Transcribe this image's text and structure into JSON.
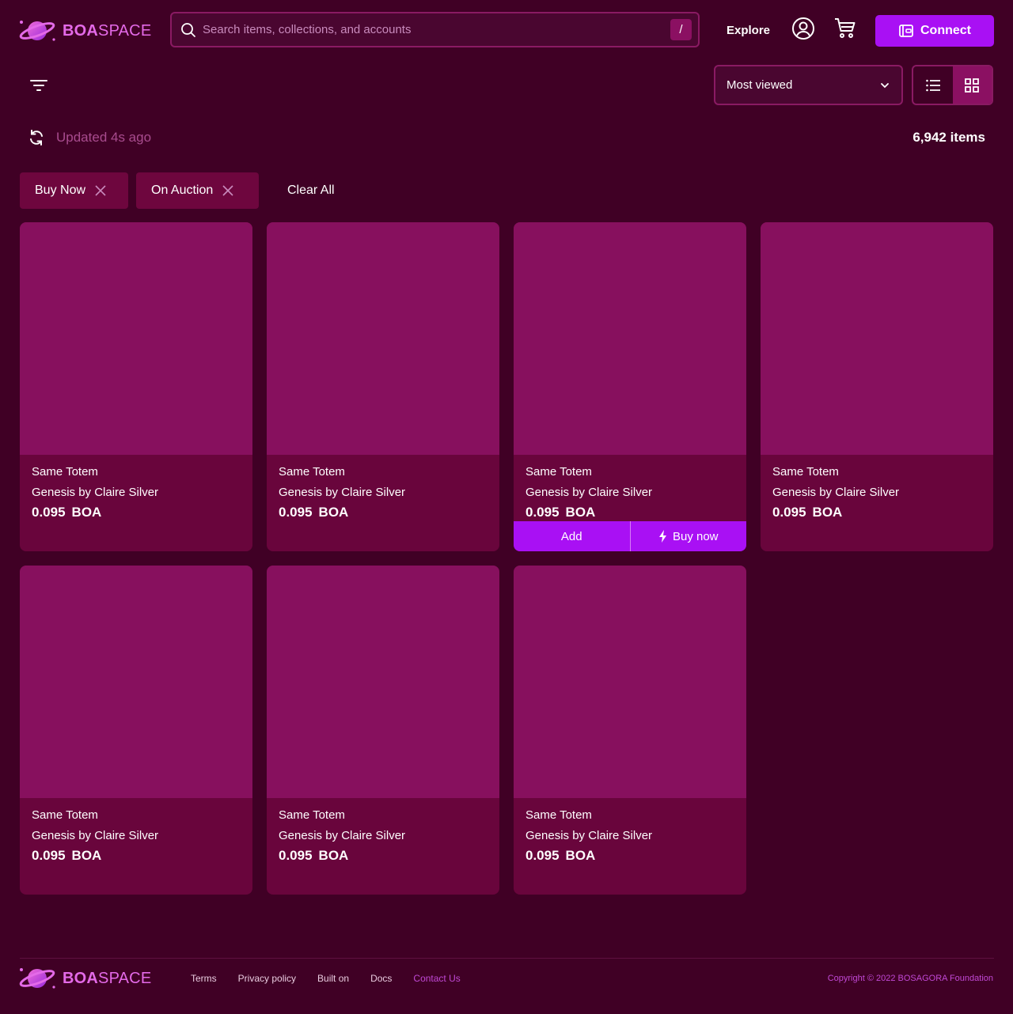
{
  "brand": {
    "name_bold": "BOA",
    "name_light": "SPACE"
  },
  "header": {
    "search_placeholder": "Search items, collections, and accounts",
    "search_shortcut": "/",
    "explore_label": "Explore",
    "connect_label": "Connect"
  },
  "toolbar": {
    "sort_selected": "Most viewed",
    "updated_text": "Updated 4s ago",
    "item_count": "6,942 items",
    "view_mode": "grid"
  },
  "filters": {
    "chips": [
      {
        "label": "Buy Now"
      },
      {
        "label": "On Auction"
      }
    ],
    "clear_label": "Clear All"
  },
  "items": [
    {
      "name": "Same Totem",
      "collection": "Genesis by Claire Silver",
      "price": "0.095",
      "currency": "BOA"
    },
    {
      "name": "Same Totem",
      "collection": "Genesis by Claire Silver",
      "price": "0.095",
      "currency": "BOA"
    },
    {
      "name": "Same Totem",
      "collection": "Genesis by Claire Silver",
      "price": "0.095",
      "currency": "BOA",
      "add_label": "Add",
      "buy_label": "Buy now"
    },
    {
      "name": "Same Totem",
      "collection": "Genesis by Claire Silver",
      "price": "0.095",
      "currency": "BOA"
    },
    {
      "name": "Same Totem",
      "collection": "Genesis by Claire Silver",
      "price": "0.095",
      "currency": "BOA"
    },
    {
      "name": "Same Totem",
      "collection": "Genesis by Claire Silver",
      "price": "0.095",
      "currency": "BOA"
    },
    {
      "name": "Same Totem",
      "collection": "Genesis by Claire Silver",
      "price": "0.095",
      "currency": "BOA"
    }
  ],
  "footer": {
    "links": [
      "Terms",
      "Privacy policy",
      "Built on",
      "Docs",
      "Contact Us"
    ],
    "copyright": "Copyright © 2022 BOSAGORA Foundation"
  },
  "colors": {
    "background": "#400025",
    "card": "#69053c",
    "card_image": "#87105e",
    "accent": "#a910f4",
    "brand_pink": "#e46ae8"
  }
}
